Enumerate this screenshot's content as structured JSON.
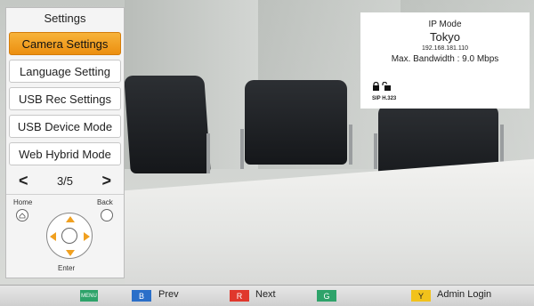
{
  "menu": {
    "title": "Settings",
    "items": [
      {
        "label": "Camera Settings",
        "active": true
      },
      {
        "label": "Language Setting",
        "active": false
      },
      {
        "label": "USB Rec Settings",
        "active": false
      },
      {
        "label": "USB Device Mode",
        "active": false
      },
      {
        "label": "Web Hybrid Mode",
        "active": false
      }
    ],
    "page": "3/5",
    "prev_icon": "chevron-left-icon",
    "next_icon": "chevron-right-icon"
  },
  "remote": {
    "home_label": "Home",
    "back_label": "Back",
    "enter_label": "Enter"
  },
  "ip_info": {
    "mode": "IP Mode",
    "name": "Tokyo",
    "address": "192.168.181.110",
    "bandwidth": "Max. Bandwidth : 9.0 Mbps",
    "protocols": "SIP H.323"
  },
  "bottom_bar": {
    "menu_key": "MENU",
    "b_key": "B",
    "b_label": "Prev",
    "r_key": "R",
    "r_label": "Next",
    "g_key": "G",
    "y_key": "Y",
    "y_label": "Admin Login",
    "colors": {
      "green": "#2ea36a",
      "blue": "#2a6fc9",
      "red": "#e0382c",
      "yellow": "#f2c21b"
    }
  }
}
